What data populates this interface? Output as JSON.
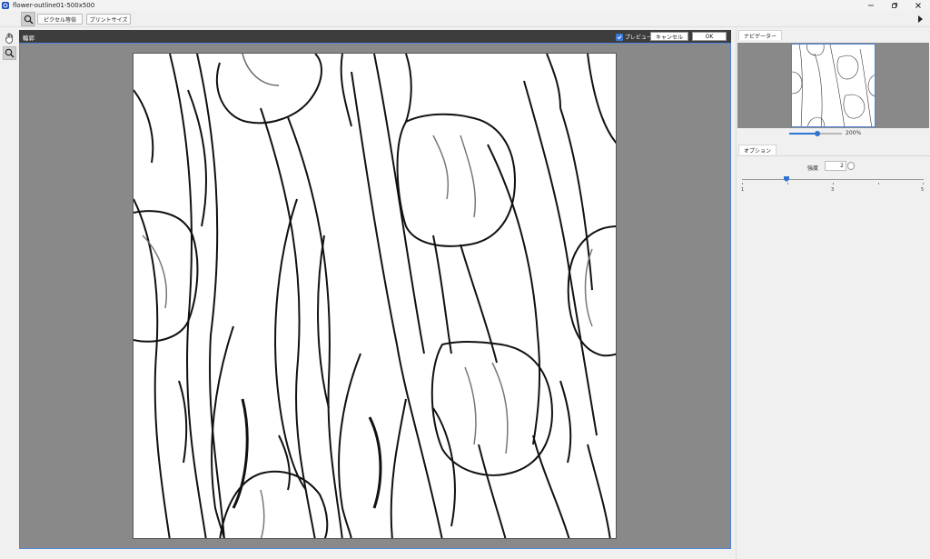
{
  "window": {
    "title": "flower-outline01-500x500",
    "controls": [
      "minimize-icon",
      "restore-icon",
      "close-icon"
    ]
  },
  "toolbar": {
    "zoom_tool_icon": "magnifier-icon",
    "pixel_equal_label": "ピクセル等倍",
    "print_size_label": "プリントサイズ",
    "panel_toggle_icon": "play-right-icon"
  },
  "left_tools": [
    {
      "name": "hand-icon"
    },
    {
      "name": "magnifier-icon",
      "active": true
    }
  ],
  "filter": {
    "title": "輪郭",
    "preview_label": "プレビュー",
    "preview_checked": true,
    "cancel_label": "キャンセル",
    "ok_label": "OK"
  },
  "navigator": {
    "tab_label": "ナビゲーター",
    "zoom_label": "200%",
    "zoom_fraction": 0.55
  },
  "options": {
    "tab_label": "オプション",
    "strength_label": "強度",
    "strength_value": "2",
    "slider_min": 1,
    "slider_max": 5,
    "slider_value": 2,
    "tick_labels": [
      "1",
      "3",
      "5"
    ]
  },
  "colors": {
    "accent": "#2f74d0",
    "canvas_bg": "#898989",
    "filter_header": "#3d3d3d"
  }
}
